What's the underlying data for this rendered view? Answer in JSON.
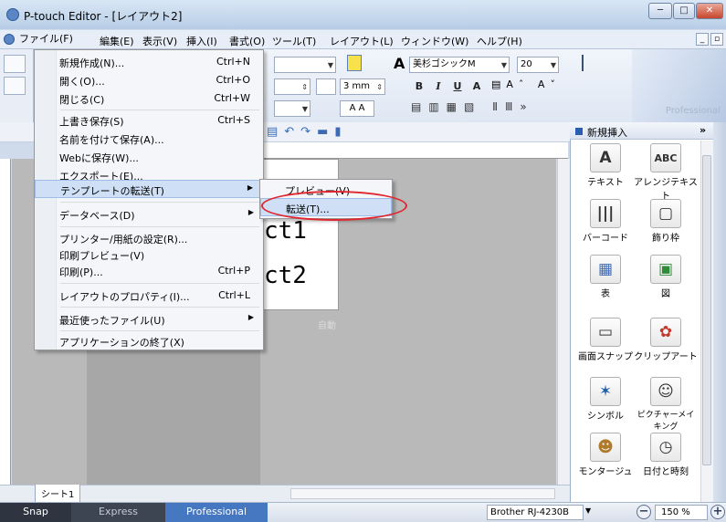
{
  "window": {
    "title": "P-touch Editor - [レイアウト2]",
    "min": "─",
    "max": "□",
    "close": "✕"
  },
  "menubar": {
    "items": [
      "ファイル(F)",
      "編集(E)",
      "表示(V)",
      "挿入(I)",
      "書式(O)",
      "ツール(T)",
      "レイアウト(L)",
      "ウィンドウ(W)",
      "ヘルプ(H)"
    ]
  },
  "toolbar": {
    "font": "美杉ゴシックM",
    "size": "20",
    "length": "3 mm",
    "fmt": [
      "B",
      "I",
      "U",
      "A"
    ]
  },
  "branding": {
    "label": "Professional"
  },
  "file_menu": {
    "items": [
      {
        "label": "新規作成(N)...",
        "shortcut": "Ctrl+N"
      },
      {
        "label": "開く(O)...",
        "shortcut": "Ctrl+O"
      },
      {
        "label": "閉じる(C)",
        "shortcut": "Ctrl+W"
      },
      {
        "label": "上書き保存(S)",
        "shortcut": "Ctrl+S"
      },
      {
        "label": "名前を付けて保存(A)...",
        "shortcut": ""
      },
      {
        "label": "Webに保存(W)...",
        "shortcut": ""
      },
      {
        "label": "エクスポート(E)...",
        "shortcut": ""
      },
      {
        "label": "テンプレートの転送(T)",
        "shortcut": ""
      },
      {
        "label": "データベース(D)",
        "shortcut": ""
      },
      {
        "label": "プリンター/用紙の設定(R)...",
        "shortcut": ""
      },
      {
        "label": "印刷プレビュー(V)",
        "shortcut": ""
      },
      {
        "label": "印刷(P)...",
        "shortcut": "Ctrl+P"
      },
      {
        "label": "レイアウトのプロパティ(I)...",
        "shortcut": "Ctrl+L"
      },
      {
        "label": "最近使ったファイル(U)",
        "shortcut": ""
      },
      {
        "label": "アプリケーションの終了(X)",
        "shortcut": ""
      }
    ]
  },
  "submenu": {
    "items": [
      "プレビュー(V)",
      "転送(T)..."
    ]
  },
  "canvas": {
    "text1": "ct1",
    "text2": "ct2",
    "auto": "自動"
  },
  "sheet": {
    "tab": "シート1"
  },
  "panel": {
    "title": "新規挿入",
    "items": [
      {
        "label": "テキスト",
        "icon": "A"
      },
      {
        "label": "アレンジテキスト",
        "icon": "ABC"
      },
      {
        "label": "バーコード",
        "icon": "|||"
      },
      {
        "label": "飾り枠",
        "icon": "▢"
      },
      {
        "label": "表",
        "icon": "▦"
      },
      {
        "label": "図",
        "icon": "▣"
      },
      {
        "label": "画面スナップ",
        "icon": "▭"
      },
      {
        "label": "クリップアート",
        "icon": "✿"
      },
      {
        "label": "シンボル",
        "icon": "✶"
      },
      {
        "label": "ピクチャーメイキング",
        "icon": "☺"
      },
      {
        "label": "モンタージュ",
        "icon": "☻"
      },
      {
        "label": "日付と時刻",
        "icon": "◷"
      }
    ]
  },
  "statusbar": {
    "snap": "Snap",
    "express": "Express",
    "professional": "Professional",
    "printer": "Brother RJ-4230B",
    "zoom": "150 %"
  }
}
